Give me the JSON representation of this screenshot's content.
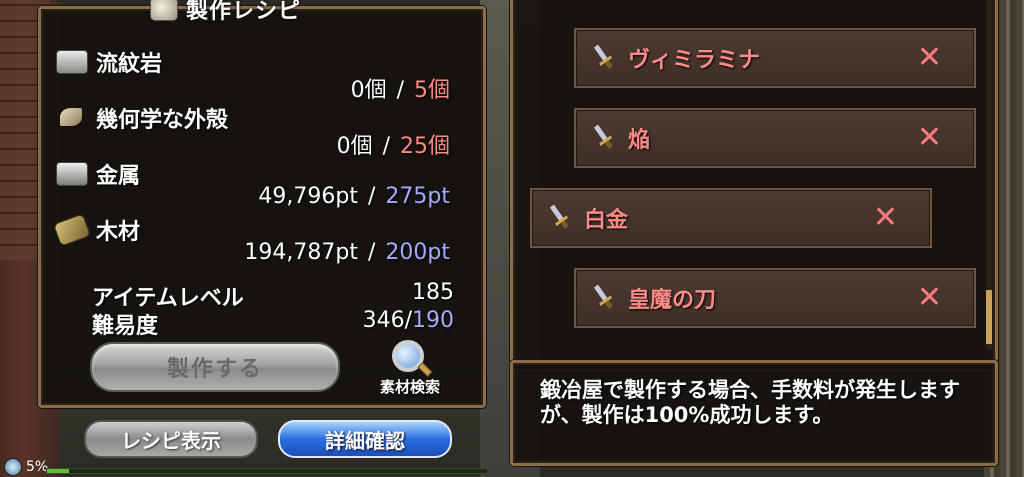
{
  "window": {
    "title": "製作レシピ"
  },
  "materials": [
    {
      "name": "流紋岩",
      "icon": "stone-icon",
      "have": "0個",
      "need": "5個",
      "need_color": "#ff8a86"
    },
    {
      "name": "幾何学な外殻",
      "icon": "shell-icon",
      "have": "0個",
      "need": "25個",
      "need_color": "#ff8a86"
    },
    {
      "name": "金属",
      "icon": "metal-icon",
      "have": "49,796pt",
      "need": "275pt",
      "need_color": "#a6a9ff"
    },
    {
      "name": "木材",
      "icon": "wood-icon",
      "have": "194,787pt",
      "need": "200pt",
      "need_color": "#a6a9ff"
    }
  ],
  "separator": "/",
  "stats": {
    "item_level_label": "アイテムレベル",
    "item_level_value": "185",
    "difficulty_label": "難易度",
    "difficulty_current": "346/",
    "difficulty_target": "190"
  },
  "actions": {
    "craft_label": "製作する",
    "material_search_label": "素材検索",
    "recipe_view_label": "レシピ表示",
    "detail_confirm_label": "詳細確認"
  },
  "item_list": [
    {
      "name": "ヴィミラミナ",
      "remove": "✕"
    },
    {
      "name": "焔",
      "remove": "✕"
    },
    {
      "name": "白金",
      "remove": "✕"
    },
    {
      "name": "皇魔の刀",
      "remove": "✕"
    }
  ],
  "message": {
    "text": "鍛冶屋で製作する場合、手数料が発生しますが、製作は100%成功します。"
  },
  "status": {
    "percent_text": "5%",
    "progress": 0.05
  },
  "colors": {
    "accent_red": "#ff8a86",
    "accent_blue": "#a6a9ff",
    "panel_border": "#8a6e4a"
  }
}
